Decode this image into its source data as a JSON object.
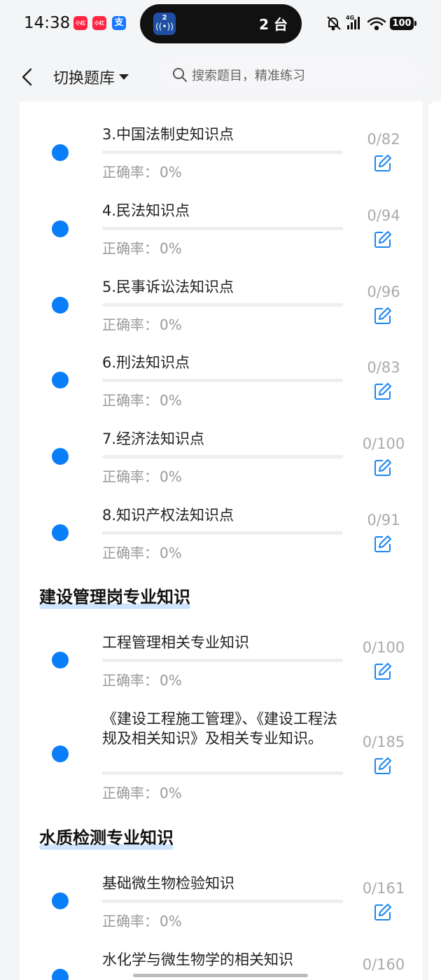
{
  "status_bar": {
    "time": "14:38",
    "badges": [
      {
        "icon": "xiaohongshu-icon",
        "label": "小红书",
        "color": "#ff2442"
      },
      {
        "icon": "xiaohongshu-icon",
        "label": "小红书",
        "color": "#ff2442"
      },
      {
        "icon": "alipay-icon",
        "label": "支",
        "color": "#1677ff"
      }
    ],
    "island": {
      "app_badge": "2",
      "text": "2 台"
    },
    "battery": "100",
    "network": "4G"
  },
  "nav": {
    "back_icon": "chevron-left-icon",
    "bank_label": "切换题库",
    "search_placeholder": "搜索题目，精准练习"
  },
  "accuracy_label": "正确率：",
  "groups": [
    {
      "heading": "",
      "items": [
        {
          "title": "3.中国法制史知识点",
          "accuracy": "0%",
          "count": "0/82",
          "progress": 0
        },
        {
          "title": "4.民法知识点",
          "accuracy": "0%",
          "count": "0/94",
          "progress": 0
        },
        {
          "title": "5.民事诉讼法知识点",
          "accuracy": "0%",
          "count": "0/96",
          "progress": 0
        },
        {
          "title": "6.刑法知识点",
          "accuracy": "0%",
          "count": "0/83",
          "progress": 0
        },
        {
          "title": "7.经济法知识点",
          "accuracy": "0%",
          "count": "0/100",
          "progress": 0
        },
        {
          "title": "8.知识产权法知识点",
          "accuracy": "0%",
          "count": "0/91",
          "progress": 0
        }
      ]
    },
    {
      "heading": "建设管理岗专业知识",
      "items": [
        {
          "title": "工程管理相关专业知识",
          "accuracy": "0%",
          "count": "0/100",
          "progress": 0
        },
        {
          "title": "《建设工程施工管理》、《建设工程法规及相关知识》及相关专业知识。",
          "accuracy": "0%",
          "count": "0/185",
          "progress": 0
        }
      ]
    },
    {
      "heading": "水质检测专业知识",
      "items": [
        {
          "title": "基础微生物检验知识",
          "accuracy": "0%",
          "count": "0/161",
          "progress": 0
        },
        {
          "title": "水化学与微生物学的相关知识",
          "accuracy": "",
          "count": "0/160",
          "progress": 0
        }
      ]
    }
  ],
  "colors": {
    "accent": "#0a7ef9",
    "muted": "#999999",
    "highlight": "#cfe5ff"
  }
}
